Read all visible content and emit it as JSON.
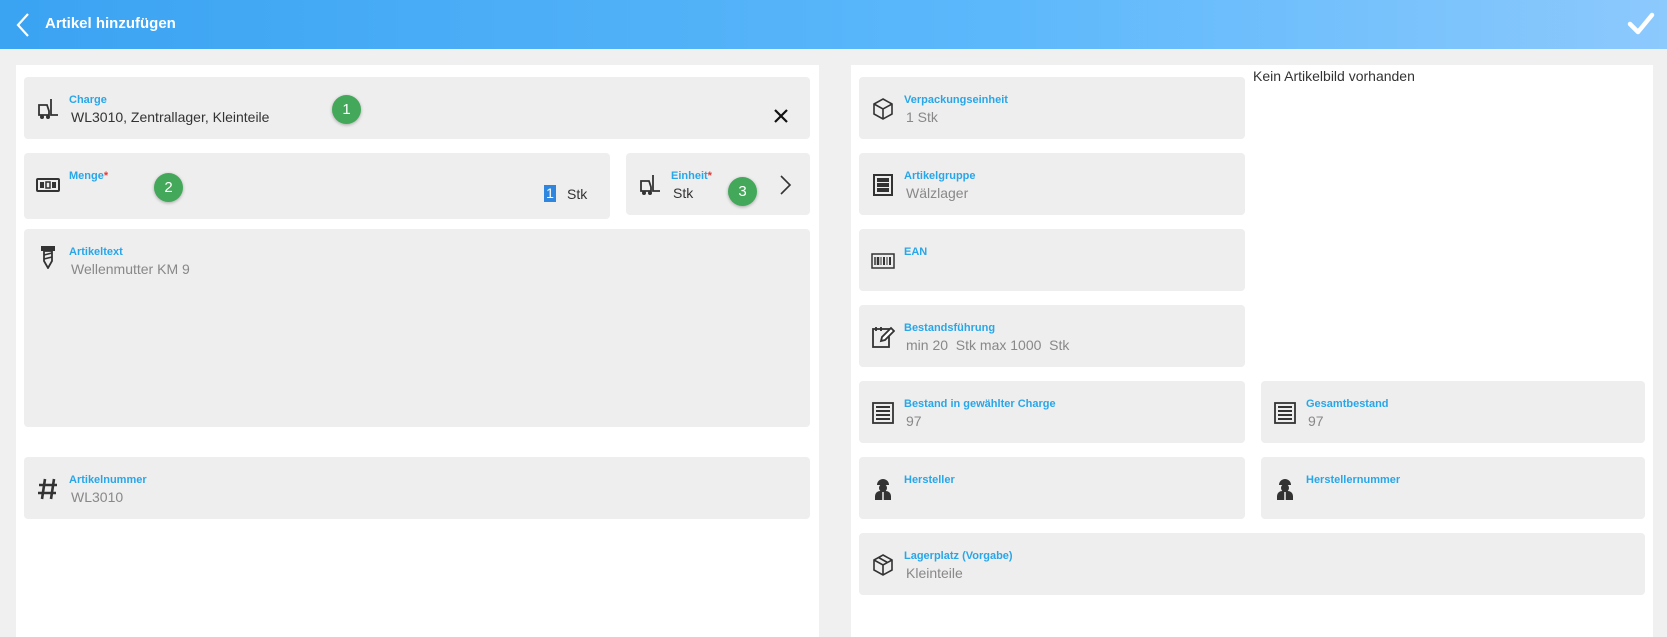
{
  "header": {
    "title": "Artikel hinzufügen",
    "back_icon": "chevron-left-icon",
    "confirm_icon": "checkmark-icon"
  },
  "left": {
    "charge": {
      "label": "Charge",
      "value": "WL3010, Zentrallager, Kleinteile",
      "icon": "forklift-icon",
      "badge": "1"
    },
    "menge": {
      "label": "Menge",
      "required": "*",
      "value": "1",
      "unit": "Stk",
      "icon": "counter-icon",
      "badge": "2"
    },
    "einheit": {
      "label": "Einheit",
      "required": "*",
      "value": "Stk",
      "icon": "forklift-icon",
      "badge": "3"
    },
    "artikeltext": {
      "label": "Artikeltext",
      "value": "Wellenmutter KM 9",
      "icon": "screw-icon"
    },
    "artikelnummer": {
      "label": "Artikelnummer",
      "value": "WL3010",
      "icon": "hash-icon"
    }
  },
  "right": {
    "no_image": "Kein Artikelbild vorhanden",
    "verpackungseinheit": {
      "label": "Verpackungseinheit",
      "value": "1 Stk",
      "icon": "box-icon"
    },
    "artikelgruppe": {
      "label": "Artikelgruppe",
      "value": "Wälzlager",
      "icon": "shelf-icon"
    },
    "ean": {
      "label": "EAN",
      "value": "",
      "icon": "barcode-icon"
    },
    "bestandsfuehrung": {
      "label": "Bestandsführung",
      "value": "min 20  Stk max 1000  Stk",
      "icon": "edit-icon"
    },
    "bestand_charge": {
      "label": "Bestand in gewählter Charge",
      "value": "97",
      "icon": "list-icon"
    },
    "gesamtbestand": {
      "label": "Gesamtbestand",
      "value": "97",
      "icon": "list-icon"
    },
    "hersteller": {
      "label": "Hersteller",
      "value": "",
      "icon": "worker-icon"
    },
    "herstellernummer": {
      "label": "Herstellernummer",
      "value": "",
      "icon": "worker-icon"
    },
    "lagerplatz": {
      "label": "Lagerplatz (Vorgabe)",
      "value": "Kleinteile",
      "icon": "package-icon"
    }
  },
  "colors": {
    "header": "#3aa3f2",
    "label": "#29a6e8",
    "badge": "#43a85a",
    "card": "#eeeeee"
  }
}
